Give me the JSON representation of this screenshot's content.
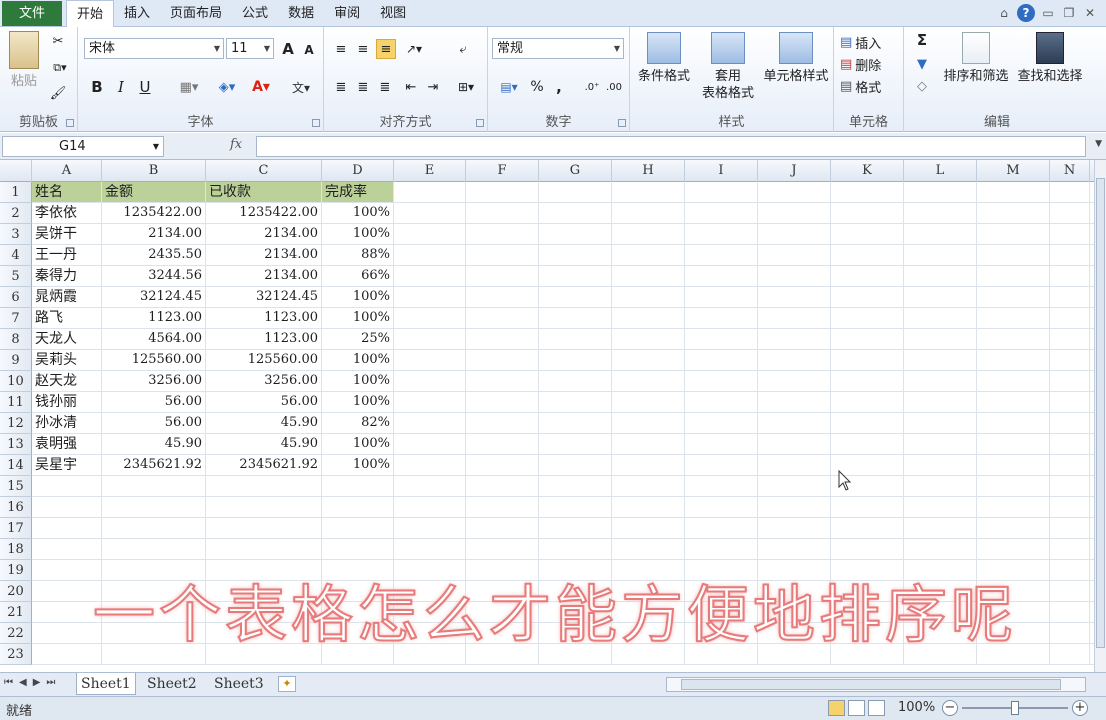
{
  "tabs": {
    "file": "文件",
    "items": [
      "开始",
      "插入",
      "页面布局",
      "公式",
      "数据",
      "审阅",
      "视图"
    ],
    "active_index": 0
  },
  "ribbon": {
    "clipboard": {
      "label": "剪贴板",
      "paste": "粘贴"
    },
    "font": {
      "label": "字体",
      "family": "宋体",
      "size": "11",
      "bold": "B",
      "italic": "I",
      "underline": "U",
      "grow": "A",
      "shrink": "A"
    },
    "alignment": {
      "label": "对齐方式"
    },
    "number": {
      "label": "数字",
      "format": "常规",
      "percent": "%",
      "comma": ","
    },
    "styles": {
      "label": "样式",
      "conditional": "条件格式",
      "table1": "套用",
      "table2": "表格格式",
      "cell_styles": "单元格样式"
    },
    "cells": {
      "label": "单元格",
      "insert": "插入",
      "delete": "删除",
      "format": "格式"
    },
    "editing": {
      "label": "编辑",
      "sort_filter": "排序和筛选",
      "find_select": "查找和选择",
      "sigma": "Σ"
    }
  },
  "formula_bar": {
    "name_box": "G14",
    "fx": "fx",
    "value": ""
  },
  "columns": [
    "A",
    "B",
    "C",
    "D",
    "E",
    "F",
    "G",
    "H",
    "I",
    "J",
    "K",
    "L",
    "M",
    "N"
  ],
  "rows_count": 23,
  "table": {
    "headers": [
      "姓名",
      "金额",
      "已收款",
      "完成率"
    ],
    "rows": [
      [
        "李依依",
        "1235422.00",
        "1235422.00",
        "100%"
      ],
      [
        "吴饼干",
        "2134.00",
        "2134.00",
        "100%"
      ],
      [
        "王一丹",
        "2435.50",
        "2134.00",
        "88%"
      ],
      [
        "秦得力",
        "3244.56",
        "2134.00",
        "66%"
      ],
      [
        "晁炳霞",
        "32124.45",
        "32124.45",
        "100%"
      ],
      [
        "路飞",
        "1123.00",
        "1123.00",
        "100%"
      ],
      [
        "天龙人",
        "4564.00",
        "1123.00",
        "25%"
      ],
      [
        "吴莉头",
        "125560.00",
        "125560.00",
        "100%"
      ],
      [
        "赵天龙",
        "3256.00",
        "3256.00",
        "100%"
      ],
      [
        "钱孙丽",
        "56.00",
        "56.00",
        "100%"
      ],
      [
        "孙冰清",
        "56.00",
        "45.90",
        "82%"
      ],
      [
        "袁明强",
        "45.90",
        "45.90",
        "100%"
      ],
      [
        "吴星宇",
        "2345621.92",
        "2345621.92",
        "100%"
      ]
    ]
  },
  "sheets": [
    "Sheet1",
    "Sheet2",
    "Sheet3"
  ],
  "status": {
    "ready": "就绪",
    "zoom": "100%"
  },
  "caption": "一个表格怎么才能方便地排序呢",
  "colors": {
    "header_fill": "#bcd19a",
    "file_tab": "#2d7a3a",
    "caption_stroke": "#e77a7a"
  }
}
